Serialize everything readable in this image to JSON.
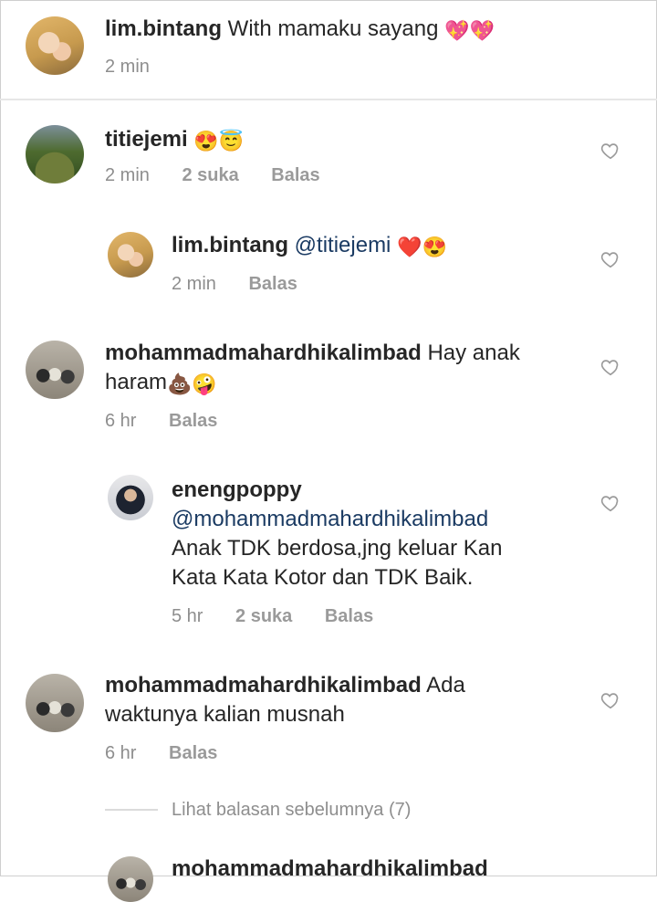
{
  "post_caption": {
    "username": "lim.bintang",
    "text": "With mamaku sayang",
    "emoji": "💖💖",
    "time": "2 min"
  },
  "comments": [
    {
      "username": "titiejemi",
      "text": "",
      "emoji": "😍😇",
      "time": "2 min",
      "likes": "2 suka",
      "reply": "Balas"
    },
    {
      "username": "lim.bintang",
      "mention": "@titiejemi",
      "emoji": "❤️😍",
      "time": "2 min",
      "reply": "Balas"
    },
    {
      "username": "mohammadmahardhikalimbad",
      "text_line1": "Hay anak",
      "text_line2": "haram",
      "emoji": "💩🤪",
      "time": "6 hr",
      "reply": "Balas"
    },
    {
      "username": "enengpoppy",
      "mention": "@mohammadmahardhikalimbad",
      "text_line1": "Anak TDK berdosa,jng keluar Kan",
      "text_line2": "Kata Kata Kotor dan TDK Baik.",
      "time": "5 hr",
      "likes": "2 suka",
      "reply": "Balas"
    },
    {
      "username": "mohammadmahardhikalimbad",
      "text_line1": "Ada",
      "text_line2": "waktunya kalian musnah",
      "time": "6 hr",
      "reply": "Balas"
    },
    {
      "username": "mohammadmahardhikalimbad"
    }
  ],
  "view_previous_replies": "Lihat balasan sebelumnya (7)"
}
